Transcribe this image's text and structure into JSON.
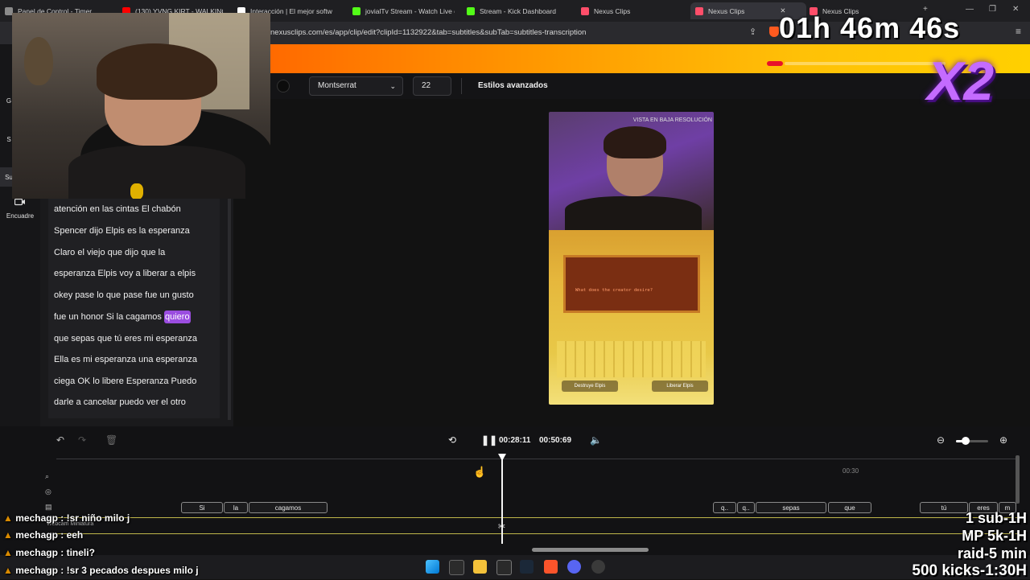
{
  "tabs": [
    {
      "label": "Panel de Control - Timer",
      "color": "#8a8a8a"
    },
    {
      "label": "(130) YVNG KIRT - WALKING II",
      "color": "#ff0000"
    },
    {
      "label": "Interacción | El mejor softw",
      "color": "#ffffff"
    },
    {
      "label": "jovialTv Stream - Watch Live o",
      "color": "#53fc18"
    },
    {
      "label": "Stream - Kick Dashboard",
      "color": "#53fc18"
    },
    {
      "label": "Nexus Clips",
      "color": "#ff4e6a"
    },
    {
      "label": "Nexus Clips",
      "color": "#ff4e6a"
    },
    {
      "label": "Nexus Clips",
      "color": "#ff4e6a"
    }
  ],
  "address": {
    "url": "nexusclips.com/es/app/clip/edit?clipId=1132922&tab=subtitles&subTab=subtitles-transcription"
  },
  "toolbar": {
    "font": "Montserrat",
    "font_size": "22",
    "advanced_label": "Estilos avanzados"
  },
  "sidebar": {
    "items": [
      "G",
      "S",
      "Su",
      "Encuadre"
    ]
  },
  "transcript": {
    "lines": [
      "atención en las cintas El chabón",
      "Spencer dijo Elpis es la esperanza",
      "Claro el viejo que dijo que la",
      "esperanza Elpis voy a liberar a elpis",
      "okey pase lo que pase fue un gusto",
      "que sepas que tú eres mi esperanza",
      "Ella es mi esperanza una esperanza",
      "ciega OK lo libere Esperanza Puedo",
      "darle a cancelar puedo ver el otro"
    ],
    "line6_before": "fue un honor Si la cagamos ",
    "highlight": "quiero"
  },
  "preview": {
    "low_res_label": "VISTA EN BAJA RESOLUCIÓN",
    "screen_text": "What does the creator desire?",
    "button_left": "Destruye Elpis",
    "button_right": "Liberar Elpis"
  },
  "player": {
    "current_time": "00:28:11",
    "duration": "00:50:69",
    "tick_label": "00:30"
  },
  "timeline": {
    "segments": [
      "Si",
      "la",
      "cagamos",
      "q..",
      "q..",
      "sepas",
      "que",
      "tú",
      "eres",
      "m"
    ],
    "webcam_track": "Webcam Miniatura"
  },
  "overlay": {
    "timer": "01h 46m 46s",
    "multiplier": "X2",
    "chat": [
      "mechagp : !sr niño milo j",
      "mechagp : eeh",
      "mechagp : tineli?",
      "mechagp : !sr 3 pecados despues milo j"
    ],
    "goals": [
      "1 sub-1H",
      "MP 5k-1H",
      "raid-5 min",
      "500 kicks-1:30H"
    ]
  },
  "colors": {
    "accent": "#9b4de0",
    "banner_start": "#ff6a00",
    "banner_end": "#ffd000"
  }
}
